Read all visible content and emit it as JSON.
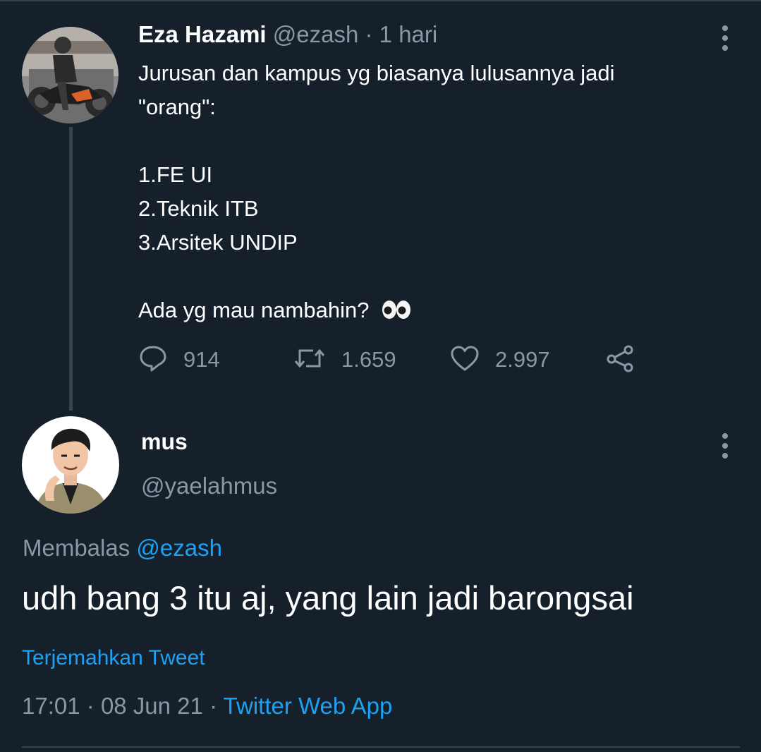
{
  "tweet": {
    "author_name": "Eza Hazami",
    "handle": "@ezash",
    "separator": "·",
    "time_ago": "1 hari",
    "lines": [
      "Jurusan dan kampus yg biasanya lulusannya jadi",
      "\"orang\":",
      "",
      "1.FE UI",
      "2.Teknik ITB",
      "3.Arsitek UNDIP",
      "",
      "Ada yg mau nambahin?"
    ],
    "emoji": "eyes-emoji",
    "reply_count": "914",
    "retweet_count": "1.659",
    "like_count": "2.997",
    "icons": {
      "reply": "reply-icon",
      "retweet": "retweet-icon",
      "like": "heart-icon",
      "share": "share-icon",
      "more": "more-vertical-icon"
    }
  },
  "reply": {
    "author_name": "mus",
    "handle": "@yaelahmus",
    "replying_label": "Membalas",
    "replying_to": "@ezash",
    "text": "udh bang 3 itu aj, yang lain jadi barongsai",
    "translate_label": "Terjemahkan Tweet",
    "time": "17:01",
    "date": "08 Jun 21",
    "separator": "·",
    "source": "Twitter Web App"
  },
  "colors": {
    "background": "#15202b",
    "muted": "#8899a6",
    "accent": "#1da1f2",
    "divider": "#38444d"
  }
}
